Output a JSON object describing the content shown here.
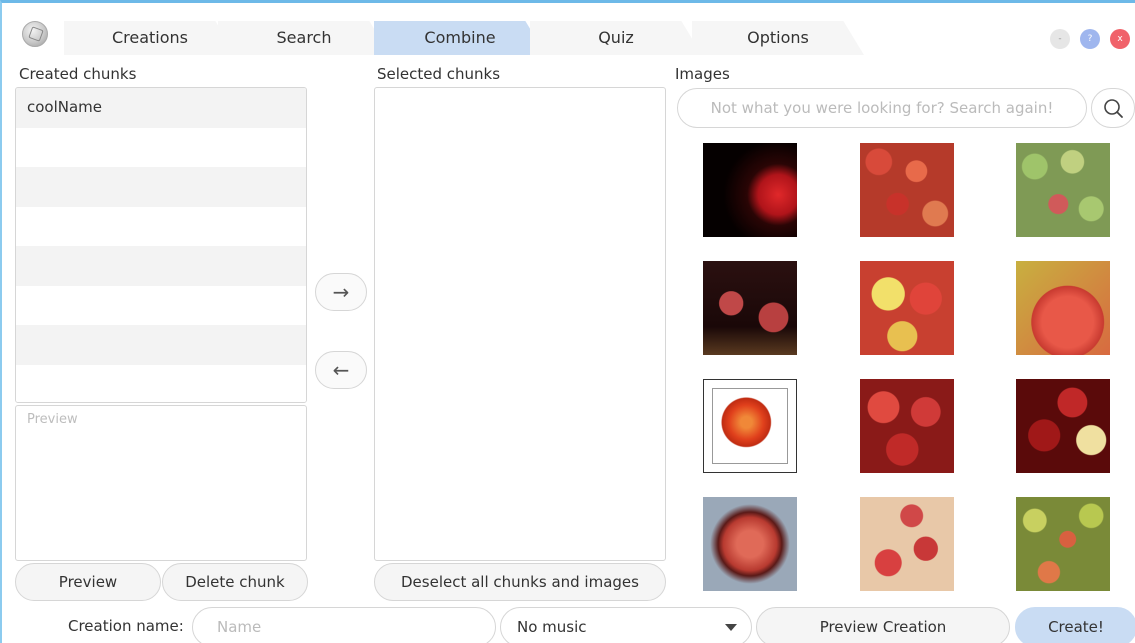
{
  "tabs": [
    {
      "label": "Creations",
      "active": false
    },
    {
      "label": "Search",
      "active": false
    },
    {
      "label": "Combine",
      "active": true
    },
    {
      "label": "Quiz",
      "active": false
    },
    {
      "label": "Options",
      "active": false
    }
  ],
  "window_controls": {
    "minimize": "-",
    "help": "?",
    "close": "x"
  },
  "created_chunks": {
    "label": "Created chunks",
    "items": [
      "coolName",
      "",
      "",
      "",
      "",
      "",
      "",
      ""
    ]
  },
  "preview": {
    "placeholder": "Preview"
  },
  "buttons": {
    "preview": "Preview",
    "delete_chunk": "Delete chunk",
    "move_right": "→",
    "move_left": "←",
    "deselect_all": "Deselect all chunks and images",
    "preview_creation": "Preview Creation",
    "create": "Create!"
  },
  "selected_chunks": {
    "label": "Selected chunks"
  },
  "images": {
    "label": "Images",
    "search_placeholder": "Not what you were looking for? Search again!",
    "selected_index": 6
  },
  "bottom": {
    "creation_name_label": "Creation name:",
    "name_placeholder": "Name",
    "music_value": "No music"
  },
  "colors": {
    "accent": "#c9dcf3",
    "close": "#f0626a",
    "help": "#9fb6ee",
    "minimize": "#e6e6e6",
    "border": "#6db9e8"
  }
}
